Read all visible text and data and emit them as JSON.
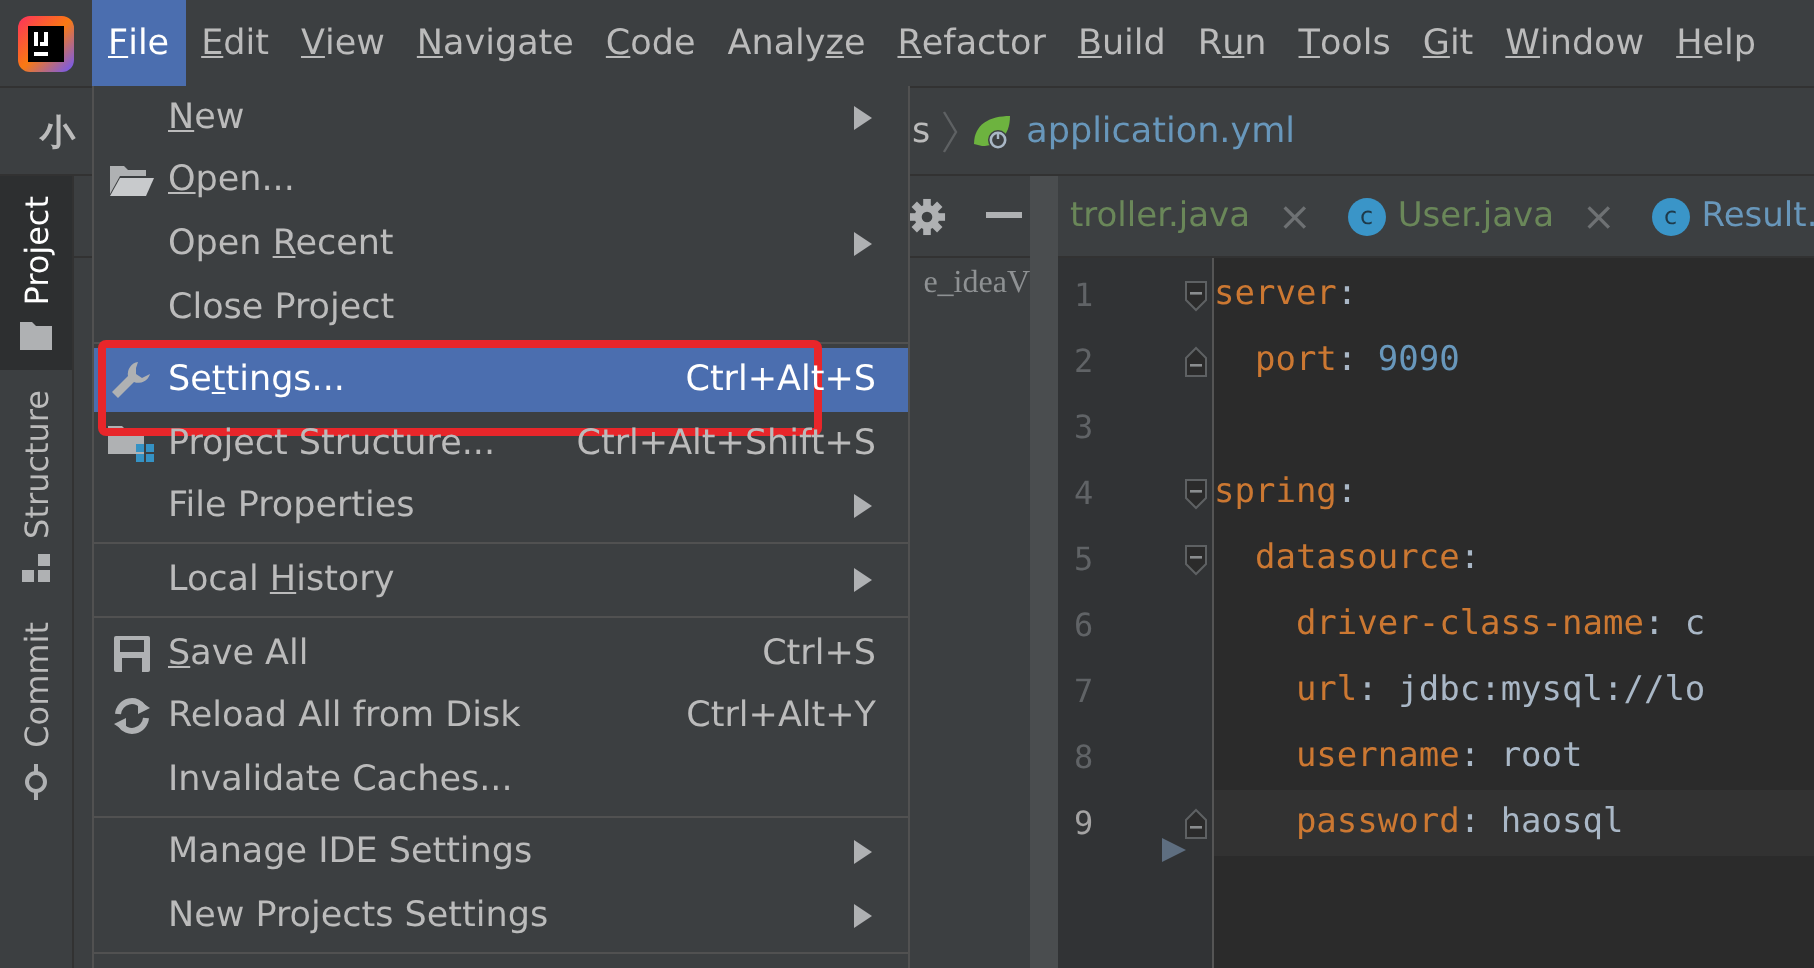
{
  "menu_bar": {
    "items": [
      {
        "mnemonic": "F",
        "end": "ile",
        "selected": true
      },
      {
        "mnemonic": "E",
        "end": "dit",
        "selected": false
      },
      {
        "mnemonic": "V",
        "end": "iew",
        "selected": false
      },
      {
        "mnemonic": "N",
        "end": "avigate",
        "selected": false
      },
      {
        "mnemonic": "C",
        "end": "ode",
        "selected": false
      },
      {
        "start": "Analy",
        "mnemonic": "z",
        "end": "e",
        "selected": false
      },
      {
        "mnemonic": "R",
        "end": "efactor",
        "selected": false
      },
      {
        "mnemonic": "B",
        "end": "uild",
        "selected": false
      },
      {
        "start": "R",
        "mnemonic": "u",
        "end": "n",
        "selected": false
      },
      {
        "mnemonic": "T",
        "end": "ools",
        "selected": false
      },
      {
        "mnemonic": "G",
        "end": "it",
        "selected": false
      },
      {
        "mnemonic": "W",
        "end": "indow",
        "selected": false
      },
      {
        "mnemonic": "H",
        "end": "elp",
        "selected": false
      }
    ]
  },
  "navigation_bar": {
    "project": "小",
    "path_tail": "s",
    "file": "application.yml"
  },
  "tool_strip": [
    {
      "label": "Project",
      "selected": true
    },
    {
      "label": "Structure",
      "selected": false
    },
    {
      "label": "Commit",
      "selected": false
    }
  ],
  "project_panel": {
    "visible_text": "e_ideaV"
  },
  "editor_tabs": [
    {
      "label": "troller.java",
      "close": "×",
      "color": "#6a8759"
    },
    {
      "label": "User.java",
      "badge": "c",
      "close": "×",
      "color": "#6a8759"
    },
    {
      "label": "Result.",
      "badge": "c",
      "color": "#6897bb"
    }
  ],
  "code_lines": [
    {
      "number": "1",
      "fold_open": true,
      "fold_close": false,
      "current": false,
      "parts": [
        {
          "kind": "key",
          "t": "server"
        },
        {
          "kind": "punct",
          "t": ":"
        }
      ]
    },
    {
      "number": "2",
      "fold_open": false,
      "fold_close": true,
      "current": false,
      "parts": [
        {
          "kind": "key",
          "t": "  port"
        },
        {
          "kind": "punct",
          "t": ": "
        },
        {
          "kind": "number",
          "t": "9090"
        }
      ]
    },
    {
      "number": "3",
      "fold_open": false,
      "fold_close": false,
      "current": false
    },
    {
      "number": "4",
      "fold_open": true,
      "fold_close": false,
      "current": false,
      "parts": [
        {
          "kind": "key",
          "t": "spring"
        },
        {
          "kind": "punct",
          "t": ":"
        }
      ]
    },
    {
      "number": "5",
      "fold_open": true,
      "fold_close": false,
      "current": false,
      "parts": [
        {
          "kind": "key",
          "t": "  datasource"
        },
        {
          "kind": "punct",
          "t": ":"
        }
      ]
    },
    {
      "number": "6",
      "fold_open": false,
      "fold_close": false,
      "current": false,
      "parts": [
        {
          "kind": "key",
          "t": "    driver-class-name"
        },
        {
          "kind": "punct",
          "t": ": "
        },
        {
          "kind": "value",
          "t": "c"
        }
      ]
    },
    {
      "number": "7",
      "fold_open": false,
      "fold_close": false,
      "current": false,
      "parts": [
        {
          "kind": "key",
          "t": "    url"
        },
        {
          "kind": "punct",
          "t": ": "
        },
        {
          "kind": "value",
          "t": "jdbc:mysql://lo"
        }
      ]
    },
    {
      "number": "8",
      "fold_open": false,
      "fold_close": false,
      "current": false,
      "parts": [
        {
          "kind": "key",
          "t": "    username"
        },
        {
          "kind": "punct",
          "t": ": "
        },
        {
          "kind": "value",
          "t": "root"
        }
      ]
    },
    {
      "number": "9",
      "fold_open": false,
      "fold_close": true,
      "current": true,
      "parts": [
        {
          "kind": "key",
          "t": "    password"
        },
        {
          "kind": "punct",
          "t": ": "
        },
        {
          "kind": "value",
          "t": "haosql"
        }
      ]
    }
  ],
  "file_menu": [
    {
      "kind": "plain",
      "mnemonic": "N",
      "end": "ew",
      "submenu": true,
      "selected": false,
      "annotated": false
    },
    {
      "kind": "open",
      "mnemonic": "O",
      "end": "pen...",
      "submenu": false,
      "selected": false,
      "annotated": false
    },
    {
      "kind": "plain",
      "start": "Open ",
      "mnemonic": "R",
      "end": "ecent",
      "submenu": true,
      "selected": false,
      "annotated": false
    },
    {
      "kind": "plain",
      "start": "Close Project",
      "submenu": false,
      "selected": false,
      "annotated": false
    },
    {
      "kind": "separator"
    },
    {
      "kind": "settings",
      "start": "Se",
      "mnemonic": "t",
      "end": "tings...",
      "shortcut": "Ctrl+Alt+S",
      "submenu": false,
      "selected": true,
      "annotated": true
    },
    {
      "kind": "structure",
      "start": "Project Structure...",
      "shortcut": "Ctrl+Alt+Shift+S",
      "submenu": false,
      "selected": false,
      "annotated": false
    },
    {
      "kind": "plain",
      "start": "File Properties",
      "submenu": true,
      "selected": false,
      "annotated": false
    },
    {
      "kind": "separator"
    },
    {
      "kind": "plain",
      "start": "Local ",
      "mnemonic": "H",
      "end": "istory",
      "submenu": true,
      "selected": false,
      "annotated": false
    },
    {
      "kind": "separator"
    },
    {
      "kind": "save",
      "mnemonic": "S",
      "end": "ave All",
      "shortcut": "Ctrl+S",
      "submenu": false,
      "selected": false,
      "annotated": false
    },
    {
      "kind": "reload",
      "start": "Reload All from Disk",
      "shortcut": "Ctrl+Alt+Y",
      "submenu": false,
      "selected": false,
      "annotated": false
    },
    {
      "kind": "plain",
      "start": "Invalidate Caches...",
      "submenu": false,
      "selected": false,
      "annotated": false
    },
    {
      "kind": "separator"
    },
    {
      "kind": "plain",
      "start": "Manage IDE Settings",
      "submenu": true,
      "selected": false,
      "annotated": false
    },
    {
      "kind": "plain",
      "start": "New Projects Settings",
      "submenu": true,
      "selected": false,
      "annotated": false
    },
    {
      "kind": "separator"
    }
  ]
}
